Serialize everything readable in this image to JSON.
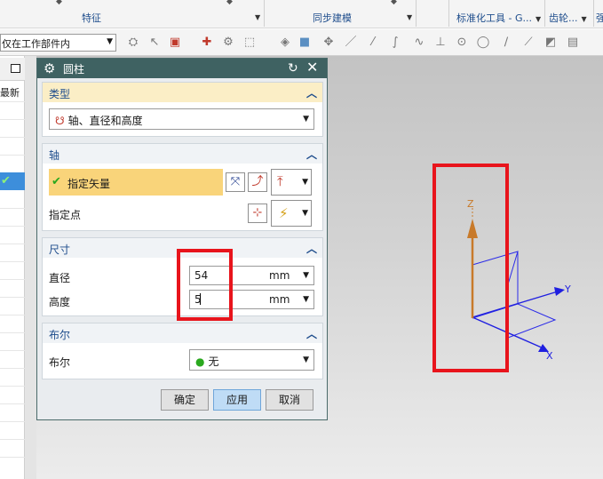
{
  "ribbon": {
    "groups": [
      {
        "label": "特征"
      },
      {
        "label": "同步建模"
      },
      {
        "label": "标准化工具 - G..."
      },
      {
        "label": "齿轮..."
      }
    ],
    "edge_char": "强"
  },
  "toolbar": {
    "selection_filter": "仅在工作部件内"
  },
  "navigator": {
    "column_header": "最新",
    "selected_check": "✔"
  },
  "dialog": {
    "title": "圆柱",
    "sections": {
      "type": {
        "title": "类型",
        "value": "轴、直径和高度"
      },
      "axis": {
        "title": "轴",
        "specify_vector": "指定矢量",
        "specify_point": "指定点"
      },
      "dimensions": {
        "title": "尺寸",
        "diameter_label": "直径",
        "diameter_value": "54",
        "diameter_unit": "mm",
        "height_label": "高度",
        "height_value": "5",
        "height_unit": "mm"
      },
      "boolean": {
        "title": "布尔",
        "label": "布尔",
        "value": "无"
      }
    },
    "buttons": {
      "ok": "确定",
      "apply": "应用",
      "cancel": "取消"
    }
  },
  "viewport": {
    "axis_labels": {
      "x": "X",
      "y": "Y",
      "z": "Z"
    }
  },
  "colors": {
    "dialog_title_bg": "#3f6262",
    "accent_blue": "#1e4d8c",
    "highlight_yellow": "#f9d47a",
    "annotation_red": "#e8141c",
    "vector_orange": "#c87a2a",
    "triad_blue": "#1f1fe0"
  }
}
